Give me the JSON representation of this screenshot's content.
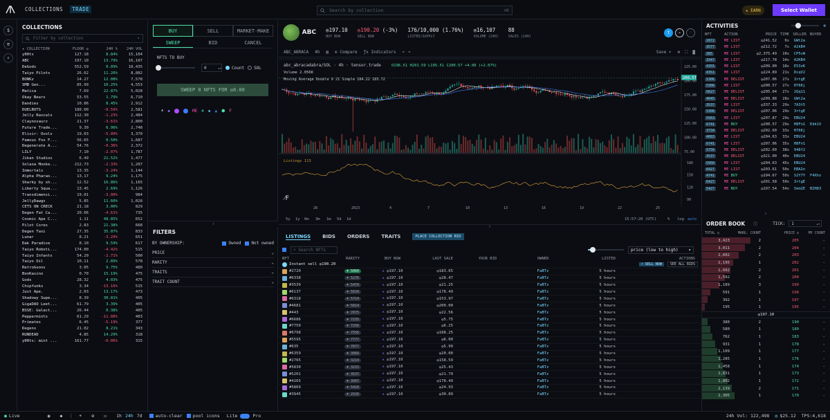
{
  "topbar": {
    "collections_tab": "COLLECTIONS",
    "trade_tab": "TRADE",
    "search_placeholder": "Search by collection",
    "search_shortcut": "⌘K",
    "earn_label": "EARN",
    "wallet_button": "Select Wallet"
  },
  "collections": {
    "title": "COLLECTIONS",
    "filter_placeholder": "Filter by collection",
    "headers": {
      "name": "COLLECTION",
      "floor": "FLOOR ◎",
      "chg": "24H %",
      "vol": "24H VOL"
    },
    "rows": [
      [
        "y00ts",
        "127.18",
        "8.84%",
        "15,104",
        "up"
      ],
      [
        "ABC",
        "197.10",
        "13.79%",
        "16,107",
        "up"
      ],
      [
        "DeGods",
        "552.59",
        "0.09%",
        "10,435",
        "up"
      ],
      [
        "Taiyo Pilots",
        "26.62",
        "11.26%",
        "8,882",
        "up"
      ],
      [
        "BONKz",
        "14.27",
        "12.08%",
        "7,578",
        "up"
      ],
      [
        "SMB Gen...",
        "85.99",
        "10.25%",
        "4,553",
        "up"
      ],
      [
        "Matica",
        "7.69",
        "22.87%",
        "5,028",
        "up"
      ],
      [
        "Okay Bears",
        "53.55",
        "1.79%",
        "6,710",
        "up"
      ],
      [
        "Dandies",
        "10.86",
        "8.45%",
        "2,912",
        "up"
      ],
      [
        "DUELBOTS",
        "180.00",
        "-0.59%",
        "2,581",
        "dn"
      ],
      [
        "Jelly Rascals",
        "112.30",
        "-1.23%",
        "2,484",
        "dn"
      ],
      [
        "Claynosaurz",
        "21.37",
        "-3.61%",
        "2,800",
        "dn"
      ],
      [
        "Future Trade...",
        "9.30",
        "6.96%",
        "2,748",
        "up"
      ],
      [
        "Elixir: Ovols",
        "19.03",
        "-5.00%",
        "3,370",
        "dn"
      ],
      [
        "Famous Fox F...",
        "56.65",
        "0.50%",
        "1,687",
        "up"
      ],
      [
        "Degenerate A...",
        "54.76",
        "-0.36%",
        "2,372",
        "dn"
      ],
      [
        "LILY",
        "7.10",
        "-2.07%",
        "1,787",
        "dn"
      ],
      [
        "Jikan Studios",
        "6.49",
        "21.52%",
        "1,477",
        "up"
      ],
      [
        "Solana Monke...",
        "212.73",
        "-2.33%",
        "1,207",
        "dn"
      ],
      [
        "Immortals",
        "13.35",
        "-3.24%",
        "1,144",
        "dn"
      ],
      [
        "Alpha Pharao...",
        "13.17",
        "9.24%",
        "1,175",
        "up"
      ],
      [
        "Sharky by sh...",
        "12.52",
        "16.86%",
        "1,165",
        "up"
      ],
      [
        "Liberty Squa...",
        "13.45",
        "2.69%",
        "1,126",
        "up"
      ],
      [
        "Transdimensi...",
        "19.01",
        "-3.00%",
        "984",
        "dn"
      ],
      [
        "JellyDawgs",
        "5.85",
        "11.60%",
        "1,028",
        "up"
      ],
      [
        "CETS ON CRECK",
        "21.18",
        "3.00%",
        "829",
        "up"
      ],
      [
        "Degen Fat Ca...",
        "20.06",
        "-4.61%",
        "735",
        "dn"
      ],
      [
        "Cosmic Ape C...",
        "1.11",
        "48.85%",
        "652",
        "up"
      ],
      [
        "Pilot Cores",
        "2.83",
        "21.38%",
        "668",
        "up"
      ],
      [
        "Degen Taxi",
        "27.35",
        "35.07%",
        "833",
        "up"
      ],
      [
        "Lunar",
        "8.21",
        "-3.29%",
        "651",
        "dn"
      ],
      [
        "Dak Paradise",
        "8.10",
        "9.59%",
        "617",
        "up"
      ],
      [
        "Taiyo Roboti...",
        "174.00",
        "-4.42%",
        "515",
        "dn"
      ],
      [
        "Taiyo Infants",
        "54.20",
        "-2.71%",
        "500",
        "dn"
      ],
      [
        "Taiyo Oil",
        "10.11",
        "2.89%",
        "578",
        "up"
      ],
      [
        "RetroGoons",
        "3.05",
        "9.75%",
        "480",
        "up"
      ],
      [
        "BonKasino",
        "0.70",
        "15.19%",
        "475",
        "up"
      ],
      [
        "Gods",
        "28.32",
        "4.03%",
        "475",
        "up"
      ],
      [
        "Chipfunks",
        "3.34",
        "-13.16%",
        "515",
        "dn"
      ],
      [
        "Just Ape.",
        "2.03",
        "13.17%",
        "473",
        "up"
      ],
      [
        "Shadowy Supe...",
        "8.39",
        "30.81%",
        "405",
        "up"
      ],
      [
        "GigaDAO Leet...",
        "61.79",
        "3.39%",
        "405",
        "up"
      ],
      [
        "BSSE: Galact...",
        "26.44",
        "0.38%",
        "405",
        "up"
      ],
      [
        "Peppermints",
        "61.29",
        "-11.00%",
        "403",
        "dn"
      ],
      [
        "Primates",
        "6.45",
        "-5.19%",
        "377",
        "dn"
      ],
      [
        "Degens",
        "21.02",
        "8.21%",
        "343",
        "up"
      ],
      [
        "RUNDEAD",
        "4.85",
        "14.29%",
        "318",
        "up"
      ],
      [
        "y00ts: mint ...",
        "161.77",
        "-0.06%",
        "315",
        "dn"
      ]
    ]
  },
  "buy": {
    "tabs": [
      "BUY",
      "SELL",
      "MARKET-MAKE"
    ],
    "subtabs": [
      "SWEEP",
      "BID",
      "CANCEL"
    ],
    "nfts_to_buy": "NFTS TO BUY",
    "qty": "0",
    "count_label": "Count",
    "sol_label": "SOL",
    "sweep_button": "SWEEP 0 NFTS FOR ◎0.00"
  },
  "filters": {
    "title": "FILTERS",
    "by_ownership": "BY OWNERSHIP:",
    "owned": "Owned",
    "not_owned": "Not owned",
    "sections": [
      "PRICE",
      "RARITY",
      "TRAITS",
      "TRAIT COUNT"
    ]
  },
  "header": {
    "name": "ABC",
    "buy_now": "◎197.10",
    "buy_now_label": "BUY NOW",
    "sell_now": "◎190.20",
    "sell_now_pct": "(-3%)",
    "sell_now_label": "SELL NOW",
    "listed": "176/10,000 (1.76%)",
    "listed_label": "LISTED/SUPPLY",
    "volume": "◎16,107",
    "volume_label": "VOLUME (24H)",
    "sales": "88",
    "sales_label": "SALES (24H)"
  },
  "tv": {
    "symbol": "ABC_ABRACA",
    "interval": "4h",
    "compare": "Compare",
    "indicators": "Indicators",
    "save": "Save",
    "legend_title": "abc_abracadabra/SOL · 4h · tensor.trade",
    "ohlc": "O196.51 H201.59 L195.51 C200.57 +4.06 (+2.07%)",
    "volume": "Volume  2.056K",
    "ma": "Moving Average Double 9 21 Simple  184.22  183.72",
    "listings": "Listings  113",
    "last_price_tag": "200.57",
    "y_ticks_price": [
      "225.00",
      "200.00",
      "175.00",
      "150.00",
      "125.00",
      "100.00",
      "75.00"
    ],
    "y_ticks_list": [
      "180",
      "150",
      "120",
      "90"
    ],
    "x_ticks": [
      "28",
      "2023",
      "4",
      "7",
      "10",
      "13",
      "16",
      "19",
      "22",
      "25"
    ],
    "ranges": [
      "5y",
      "1y",
      "6m",
      "3m",
      "1m",
      "5d",
      "1d"
    ],
    "time": "15:57:20 (UTC)",
    "pct": "%",
    "log": "log",
    "auto": "auto"
  },
  "listings": {
    "tabs": [
      "LISTINGS",
      "BIDS",
      "ORDERS",
      "TRAITS"
    ],
    "place_bid": "PLACE COLLECTION BID",
    "search_placeholder": "Search NFTs",
    "sort": "price (low to high)",
    "headers": [
      "NFT",
      "RARITY",
      "BUY NOW",
      "LAST SALE",
      "YOUR BID",
      "OWNER",
      "LISTED",
      "ACTIONS"
    ],
    "instant_sell": "Instant sell ◎190.20",
    "sell_now_btn": "SELL NOW",
    "see_all_bids": "SEE ALL BIDS",
    "rows": [
      [
        "#2720",
        "5060",
        "◎197.10",
        "◎183.65",
        "FaBTz",
        "5 hours"
      ],
      [
        "#6338",
        "5276",
        "◎197.10",
        "◎28.47",
        "FaBTz",
        "5 hours"
      ],
      [
        "#3539",
        "5470",
        "◎197.10",
        "◎21.25",
        "FaBTz",
        "5 hours"
      ],
      [
        "#6137",
        "5634",
        "◎197.10",
        "◎178.49",
        "FaBTz",
        "5 hours"
      ],
      [
        "#6318",
        "5714",
        "◎197.10",
        "◎153.97",
        "FaBTz",
        "5 hours"
      ],
      [
        "#4681",
        "5814",
        "◎197.10",
        "◎200.00",
        "FaBTz",
        "5 hours"
      ],
      [
        "#443",
        "7075",
        "◎197.10",
        "◎22.56",
        "FaBTz",
        "5 hours"
      ],
      [
        "#6686",
        "7235",
        "◎197.10",
        "◎5.75",
        "FaBTz",
        "5 hours"
      ],
      [
        "#7750",
        "7256",
        "◎197.10",
        "◎6.25",
        "FaBTz",
        "5 hours"
      ],
      [
        "#6798",
        "7556",
        "◎197.10",
        "◎188.25",
        "FaBTz",
        "5 hours"
      ],
      [
        "#5595",
        "7777",
        "◎197.10",
        "◎6.00",
        "FaBTz",
        "5 hours"
      ],
      [
        "#635",
        "7877",
        "◎197.10",
        "◎5.99",
        "FaBTz",
        "5 hours"
      ],
      [
        "#6359",
        "3066",
        "◎197.10",
        "◎20.00",
        "FaBTz",
        "5 hours"
      ],
      [
        "#2765",
        "3214",
        "◎197.10",
        "◎158.59",
        "FaBTz",
        "5 hours"
      ],
      [
        "#5830",
        "3215",
        "◎197.10",
        "◎25.43",
        "FaBTz",
        "5 hours"
      ],
      [
        "#5201",
        "3537",
        "◎197.10",
        "◎21.79",
        "FaBTz",
        "5 hours"
      ],
      [
        "#4265",
        "3907",
        "◎197.10",
        "◎178.49",
        "FaBTz",
        "5 hours"
      ],
      [
        "#5869",
        "5410",
        "◎197.10",
        "◎24.93",
        "FaBTz",
        "5 hours"
      ],
      [
        "#3945",
        "2526",
        "◎197.10",
        "◎30.89",
        "FaBTz",
        "5 hours"
      ]
    ]
  },
  "activities": {
    "title": "ACTIVITIES",
    "headers": [
      "NFT",
      "ACTION",
      "PRICE",
      "TIME",
      "SELLER",
      "BUYER"
    ],
    "rows": [
      [
        "2872",
        "LIST",
        "◎241.52",
        "6s",
        "GWt2a",
        ""
      ],
      [
        "3577",
        "LIST",
        "◎212.72",
        "7s",
        "A2kB4",
        ""
      ],
      [
        "385",
        "LIST",
        "◎2,375.49",
        "10s",
        "CP5vW",
        ""
      ],
      [
        "3347",
        "LIST",
        "◎217.78",
        "14s",
        "A2KB4",
        ""
      ],
      [
        "4355",
        "LIST",
        "◎209.00",
        "18s",
        "E53zK",
        ""
      ],
      [
        "4351",
        "LIST",
        "◎224.89",
        "21s",
        "DiqV2",
        ""
      ],
      [
        "5306",
        "DELIST",
        "◎207.06",
        "27s",
        "3rtgE",
        ""
      ],
      [
        "5306",
        "LIST",
        "◎200.57",
        "27s",
        "H76Kj",
        ""
      ],
      [
        "5627",
        "DELIST",
        "◎205.04",
        "27s",
        "2Qq11",
        ""
      ],
      [
        "4045",
        "DELIST",
        "◎209.88",
        "28s",
        "GWt2a",
        ""
      ],
      [
        "3537",
        "LIST",
        "◎337.33",
        "29s",
        "7A3t5",
        ""
      ],
      [
        "5306",
        "DELIST",
        "◎207.06",
        "29s",
        "3rtgE",
        ""
      ],
      [
        "5563",
        "LIST",
        "◎207.87",
        "29s",
        "EBU24",
        ""
      ],
      [
        "6741",
        "BUY",
        "◎200.57",
        "29s",
        "H8Fn1",
        "Edk1V"
      ],
      [
        "3734",
        "DELIST",
        "◎202.60",
        "33s",
        "H76Kj",
        ""
      ],
      [
        "4003",
        "LIST",
        "◎204.63",
        "33s",
        "EBU24",
        ""
      ],
      [
        "6741",
        "LIST",
        "◎207.06",
        "35s",
        "H8Fn1",
        ""
      ],
      [
        "5756",
        "DELIST",
        "◎202.60",
        "38s",
        "948f2",
        ""
      ],
      [
        "3537",
        "DELIST",
        "◎321.00",
        "40s",
        "EBU24",
        ""
      ],
      [
        "5956",
        "LIST",
        "◎204.63",
        "45s",
        "EBU24",
        ""
      ],
      [
        "6427",
        "LIST",
        "◎203.61",
        "50s",
        "EBA2n",
        ""
      ],
      [
        "4741",
        "BUY",
        "◎194.67",
        "50s",
        "S2Y7Y",
        "F4Xhz"
      ],
      [
        "6427",
        "DELIST",
        "◎201.58",
        "50s",
        "3rtgE",
        ""
      ],
      [
        "5427",
        "BUY",
        "◎197.54",
        "54s",
        "Skm2E",
        "BZH83"
      ]
    ]
  },
  "orderbook": {
    "title": "ORDER BOOK",
    "tick_label": "TICK:",
    "tick": "1",
    "headers": [
      "TOTAL ◎",
      "MARG. COUNT",
      "PRICE ◎",
      "MY COUNT"
    ],
    "asks": [
      [
        "3,423",
        "2",
        "205",
        "-",
        1.0
      ],
      [
        "3,011",
        "2",
        "204",
        "-",
        0.88
      ],
      [
        "2,602",
        "2",
        "203",
        "-",
        0.76
      ],
      [
        "2,195",
        "1",
        "202",
        "-",
        0.64
      ],
      [
        "1,992",
        "2",
        "201",
        "-",
        0.58
      ],
      [
        "1,592",
        "2",
        "200",
        "-",
        0.47
      ],
      [
        "1,189",
        "3",
        "199",
        "-",
        0.35
      ],
      [
        "591",
        "1",
        "198",
        "-",
        0.17
      ],
      [
        "392",
        "1",
        "197",
        "-",
        0.12
      ],
      [
        "195",
        "1",
        "195",
        "-",
        0.06
      ]
    ],
    "mid": "◎197.10",
    "bids": [
      [
        "380",
        "2",
        "190",
        "-",
        0.11
      ],
      [
        "580",
        "1",
        "180",
        "-",
        0.17
      ],
      [
        "762",
        "1",
        "183",
        "-",
        0.22
      ],
      [
        "931",
        "1",
        "178",
        "-",
        0.27
      ],
      [
        "1,109",
        "1",
        "177",
        "-",
        0.32
      ],
      [
        "1,285",
        "1",
        "176",
        "-",
        0.38
      ],
      [
        "1,458",
        "1",
        "174",
        "-",
        0.43
      ],
      [
        "1,631",
        "1",
        "173",
        "-",
        0.48
      ],
      [
        "1,802",
        "1",
        "172",
        "-",
        0.53
      ],
      [
        "2,139",
        "2",
        "171",
        "-",
        0.62
      ],
      [
        "2,305",
        "1",
        "170",
        "-",
        0.67
      ]
    ]
  },
  "statusbar": {
    "live": "Live",
    "ranges": [
      "1h",
      "24h",
      "7d"
    ],
    "auto_clear": "auto-clear",
    "pool_icons": "pool icons",
    "lite": "Lite",
    "pro": "Pro",
    "vol": "24h Vol: 122,498",
    "sol_price": "$25.12",
    "tps": "TPS:4,618"
  },
  "chart_data": {
    "type": "candlestick",
    "x": [
      "28",
      "2023",
      "4",
      "7",
      "10",
      "13",
      "16",
      "19",
      "22",
      "25"
    ],
    "ylim": [
      75,
      225
    ],
    "last_close": 200.57,
    "listings_series_last": 113
  }
}
